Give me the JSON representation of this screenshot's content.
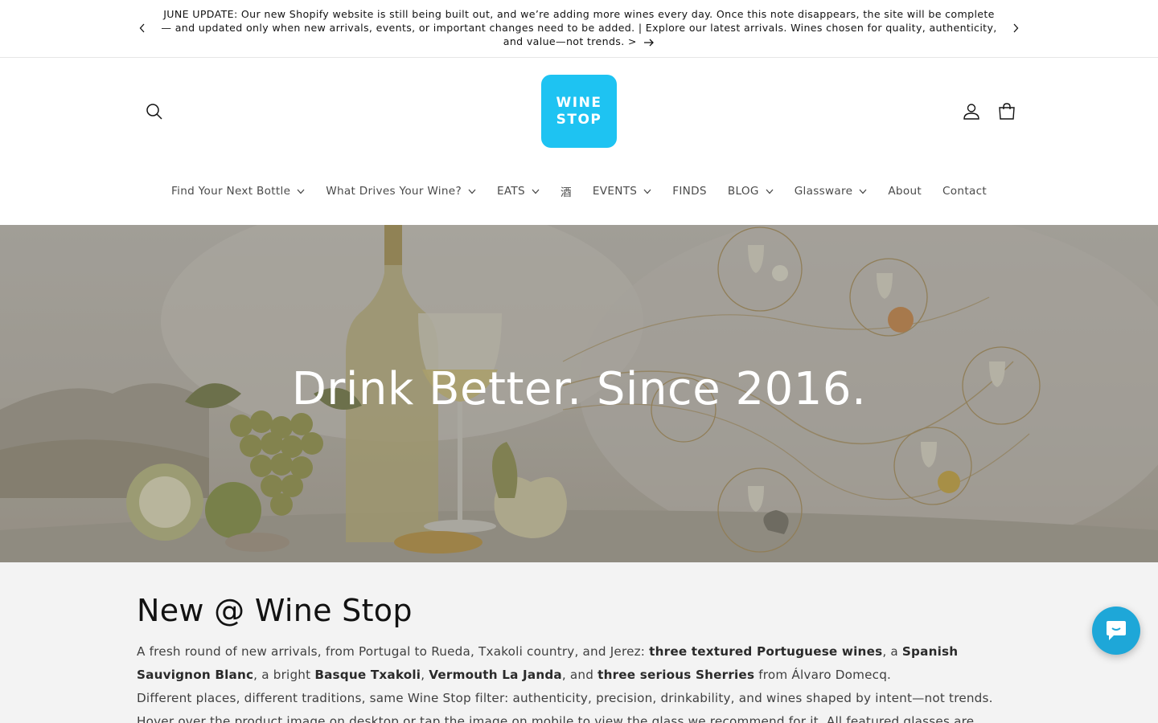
{
  "announcement": {
    "text": "JUNE UPDATE: Our new Shopify website is still being built out, and we’re adding more wines every day. Once this note disappears, the site will be complete — and updated only when new arrivals, events, or important changes need to be added. | Explore our latest arrivals. Wines chosen for quality, authenticity, and value—not trends. >",
    "prev_icon": "chevron-left-icon",
    "next_icon": "chevron-right-icon"
  },
  "header": {
    "logo_line1": "WINE",
    "logo_line2": "STOP",
    "search_icon": "search-icon",
    "account_icon": "account-icon",
    "cart_icon": "cart-icon"
  },
  "nav": {
    "items": [
      {
        "label": "Find Your Next Bottle",
        "has_dropdown": true
      },
      {
        "label": "What Drives Your Wine?",
        "has_dropdown": true
      },
      {
        "label": "EATS",
        "has_dropdown": true
      },
      {
        "label": "酒",
        "has_dropdown": false
      },
      {
        "label": "EVENTS",
        "has_dropdown": true
      },
      {
        "label": "FINDS",
        "has_dropdown": false
      },
      {
        "label": "BLOG",
        "has_dropdown": true
      },
      {
        "label": "Glassware",
        "has_dropdown": true
      },
      {
        "label": "About",
        "has_dropdown": false
      },
      {
        "label": "Contact",
        "has_dropdown": false
      }
    ]
  },
  "hero": {
    "title": "Drink Better. Since 2016."
  },
  "new_section": {
    "title": "New @ Wine Stop",
    "p1_a": "A fresh round of new arrivals, from Portugal to Rueda, Txakoli country, and Jerez: ",
    "p1_b": "three textured Portuguese wines",
    "p1_c": ", a ",
    "p1_d": "Spanish Sauvignon Blanc",
    "p1_e": ", a bright ",
    "p1_f": "Basque Txakoli",
    "p1_g": ", ",
    "p1_h": "Vermouth La Janda",
    "p1_i": ", and ",
    "p1_j": "three serious Sherries",
    "p1_k": " from Álvaro Domecq.",
    "p2": "Different places, different traditions, same Wine Stop filter: authenticity, precision, drinkability, and wines shaped by intent—not trends. Hover over the product image on desktop or tap the image on mobile to view the glass we recommend for it. All featured glasses are available for purchase on our site."
  },
  "chat": {
    "icon": "chat-icon"
  },
  "colors": {
    "brand": "#1ec3f2",
    "chat": "#1ea7d8",
    "content_bg": "#f3f3f3"
  }
}
